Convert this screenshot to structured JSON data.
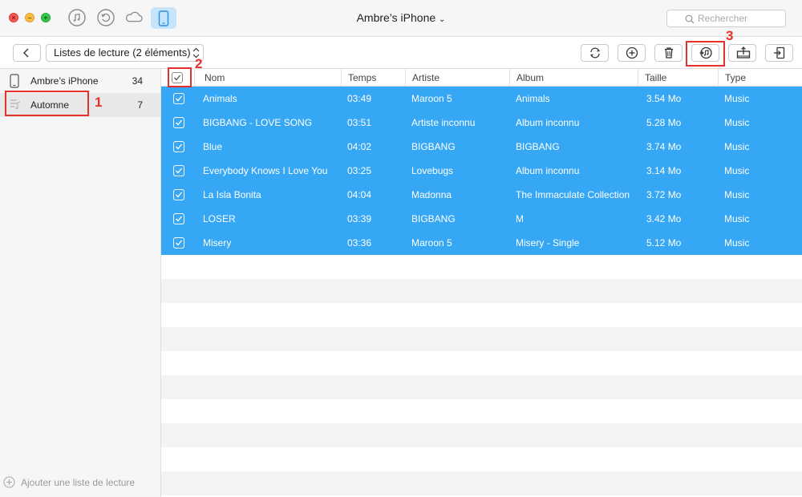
{
  "window": {
    "title": "Ambre’s iPhone"
  },
  "search": {
    "placeholder": "Rechercher"
  },
  "toolbar": {
    "playlist_select": "Listes de lecture (2 éléments)"
  },
  "sidebar": {
    "items": [
      {
        "label": "Ambre’s iPhone",
        "count": "34",
        "icon": "iphone-icon"
      },
      {
        "label": "Automne",
        "count": "7",
        "icon": "playlist-icon"
      }
    ],
    "add_label": "Ajouter une liste de lecture"
  },
  "table": {
    "columns": [
      "Nom",
      "Temps",
      "Artiste",
      "Album",
      "Taille",
      "Type"
    ],
    "rows": [
      {
        "nom": "Animals",
        "temps": "03:49",
        "artiste": "Maroon 5",
        "album": "Animals",
        "taille": "3.54 Mo",
        "type": "Music"
      },
      {
        "nom": "BIGBANG - LOVE SONG",
        "temps": "03:51",
        "artiste": "Artiste inconnu",
        "album": "Album inconnu",
        "taille": "5.28 Mo",
        "type": "Music"
      },
      {
        "nom": "Blue",
        "temps": "04:02",
        "artiste": "BIGBANG",
        "album": "BIGBANG",
        "taille": "3.74 Mo",
        "type": "Music"
      },
      {
        "nom": "Everybody Knows I Love You",
        "temps": "03:25",
        "artiste": "Lovebugs",
        "album": "Album inconnu",
        "taille": "3.14 Mo",
        "type": "Music"
      },
      {
        "nom": "La Isla Bonita",
        "temps": "04:04",
        "artiste": "Madonna",
        "album": "The Immaculate Collection",
        "taille": "3.72 Mo",
        "type": "Music"
      },
      {
        "nom": "LOSER",
        "temps": "03:39",
        "artiste": "BIGBANG",
        "album": "M",
        "taille": "3.42 Mo",
        "type": "Music"
      },
      {
        "nom": "Misery",
        "temps": "03:36",
        "artiste": "Maroon 5",
        "album": "Misery - Single",
        "taille": "5.12 Mo",
        "type": "Music"
      }
    ]
  },
  "annotations": {
    "m1": "1",
    "m2": "2",
    "m3": "3"
  },
  "colors": {
    "selection": "#35a7f5",
    "annotation": "#e5312b",
    "device_active": "#c6e4fb"
  }
}
